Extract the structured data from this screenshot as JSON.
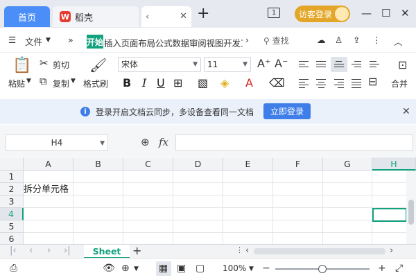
{
  "titlebar": {
    "home_tab": "首页",
    "app_tab": "稻壳",
    "app_logo": "W",
    "doc_tab_partial": "",
    "new_tab": "+",
    "badge": "1",
    "visitor_login": "访客登录",
    "minimize": "—",
    "maximize": "☐",
    "close": "✕"
  },
  "menubar": {
    "file": "文件",
    "start": "开始",
    "tabs": "插入页面布局公式数据审阅视图开发工",
    "search": "查找"
  },
  "ribbon": {
    "paste": "粘贴",
    "cut": "剪切",
    "copy": "复制",
    "format_painter": "格式刷",
    "font_name": "宋体",
    "font_size": "11",
    "bold": "B",
    "italic": "I",
    "underline": "U",
    "merge": "合并"
  },
  "notice": {
    "message": "登录开启文档云同步，多设备查看同一文档",
    "login_button": "立即登录"
  },
  "formula": {
    "cell_ref": "H4",
    "fx": "fx"
  },
  "grid": {
    "columns": [
      "A",
      "B",
      "C",
      "D",
      "E",
      "F",
      "G",
      "H"
    ],
    "rows": [
      "1",
      "2",
      "3",
      "4",
      "5",
      "6"
    ],
    "active_column": "H",
    "active_row": "4",
    "cell_A2": "拆分单元格"
  },
  "sheets": {
    "active": "Sheet",
    "add": "+"
  },
  "status": {
    "zoom": "100%",
    "minus": "−",
    "plus": "+"
  },
  "colors": {
    "accent_green": "#12a27e",
    "home_tab_blue": "#4c8ef7",
    "visitor_gold": "#e3a628",
    "login_blue": "#3f7ee8"
  }
}
